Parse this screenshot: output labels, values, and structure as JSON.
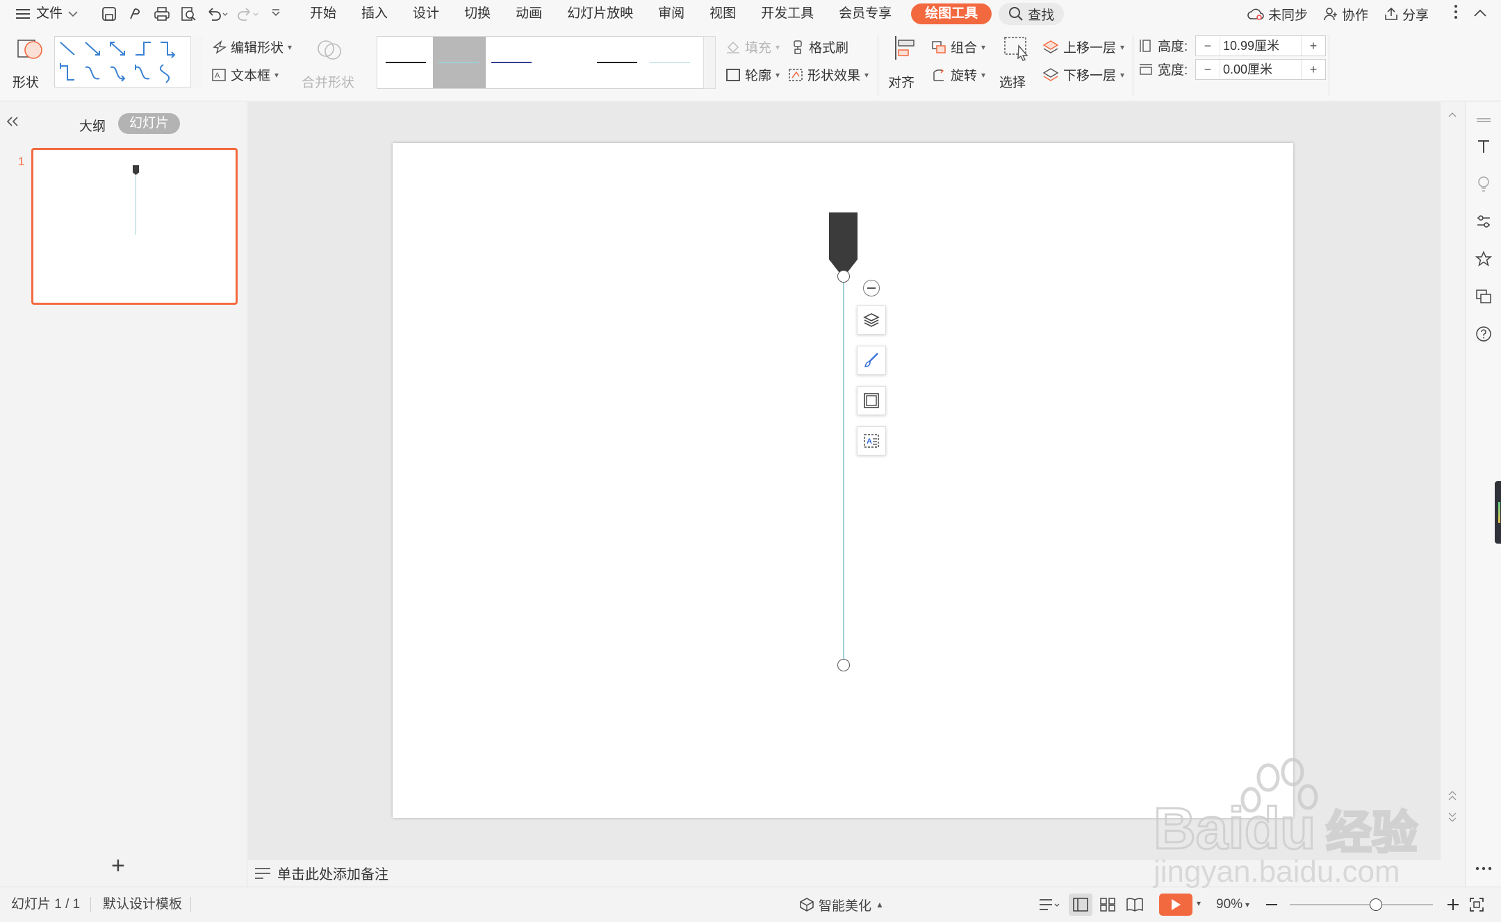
{
  "menubar": {
    "file_label": "文件",
    "tabs": [
      "开始",
      "插入",
      "设计",
      "切换",
      "动画",
      "幻灯片放映",
      "审阅",
      "视图",
      "开发工具",
      "会员专享"
    ],
    "active_tab": "绘图工具",
    "search_label": "查找",
    "sync_label": "未同步",
    "collab_label": "协作",
    "share_label": "分享"
  },
  "ribbon": {
    "shape_label": "形状",
    "edit_shape_label": "编辑形状",
    "textbox_label": "文本框",
    "merge_shape_label": "合并形状",
    "fill_label": "填充",
    "format_painter_label": "格式刷",
    "outline_label": "轮廓",
    "shape_effect_label": "形状效果",
    "align_label": "对齐",
    "group_label": "组合",
    "rotate_label": "旋转",
    "select_label": "选择",
    "bring_forward_label": "上移一层",
    "send_backward_label": "下移一层",
    "height_label": "高度:",
    "height_value": "10.99厘米",
    "width_label": "宽度:",
    "width_value": "0.00厘米",
    "line_styles": [
      {
        "color": "#222222"
      },
      {
        "color": "#9ecfd6"
      },
      {
        "color": "#2f3f8f"
      },
      {
        "color": "#ffffff"
      },
      {
        "color": "#222222"
      },
      {
        "color": "#cfe8ea"
      }
    ]
  },
  "leftpanel": {
    "outline_tab": "大纲",
    "slides_tab": "幻灯片",
    "slide_number": "1",
    "add_label": "+"
  },
  "notes": {
    "placeholder": "单击此处添加备注"
  },
  "statusbar": {
    "slide_info": "幻灯片 1 / 1",
    "template": "默认设计模板",
    "beautify": "智能美化",
    "zoom": "90%",
    "zoom_level": 0.6
  },
  "colors": {
    "accent": "#f3693f",
    "timeline_line": "#9ecfd6",
    "marker": "#3b3b3b"
  },
  "watermark": {
    "brand": "Baidu",
    "brand_cn": "经验",
    "url": "jingyan.baidu.com"
  }
}
